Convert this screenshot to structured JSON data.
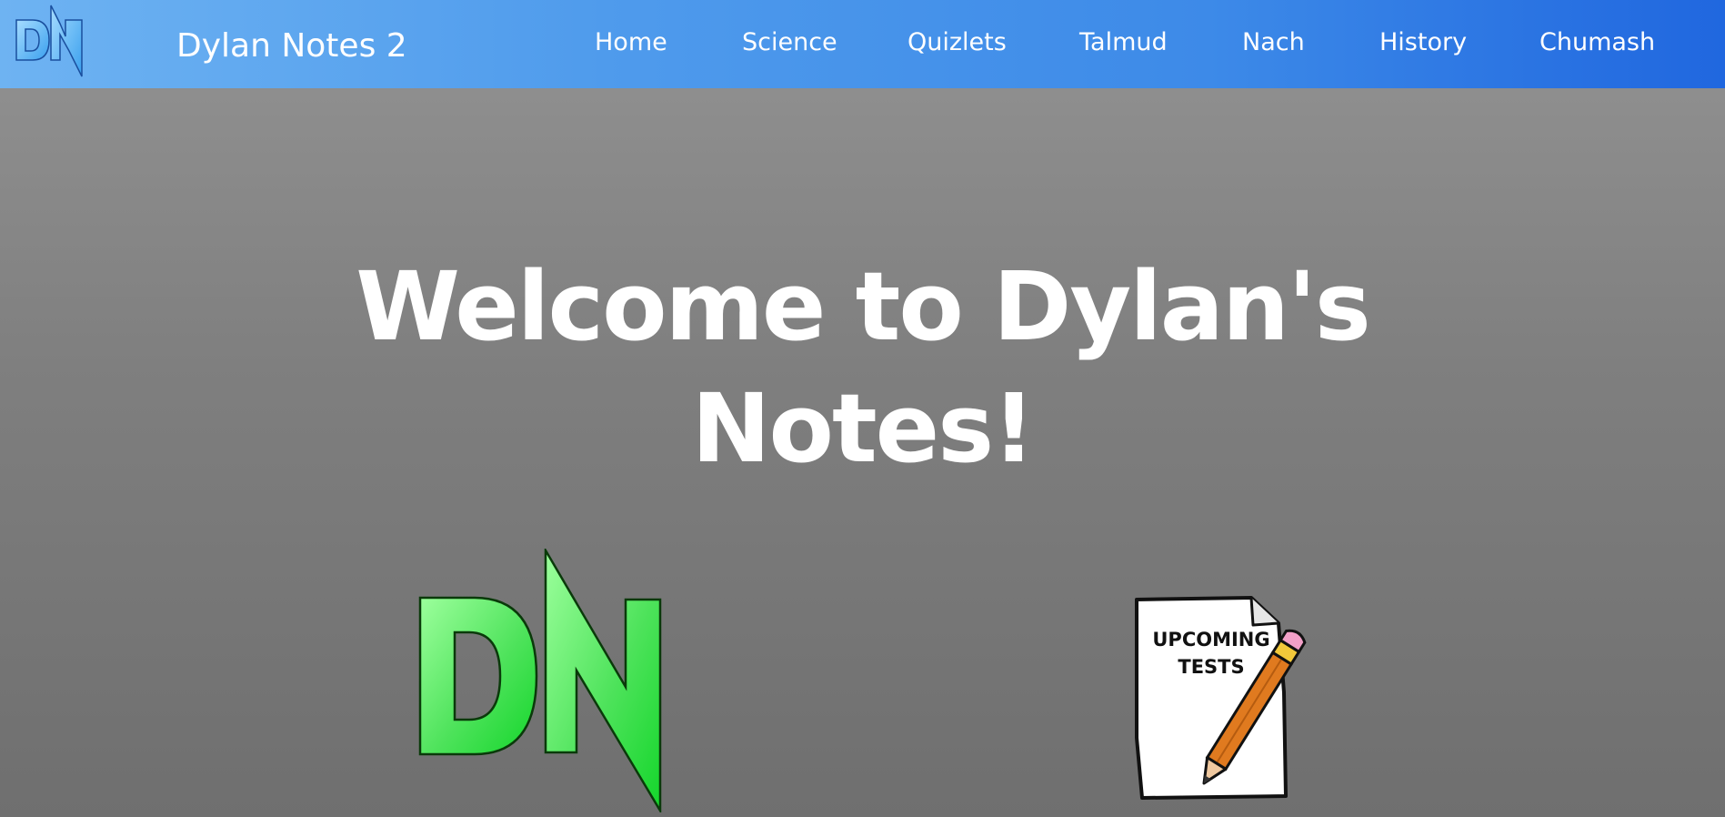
{
  "header": {
    "logo_text": "DN",
    "site_title": "Dylan Notes 2",
    "nav": [
      {
        "label": "Home"
      },
      {
        "label": "Science"
      },
      {
        "label": "Quizlets"
      },
      {
        "label": "Talmud"
      },
      {
        "label": "Nach"
      },
      {
        "label": "History"
      },
      {
        "label": "Chumash"
      }
    ]
  },
  "hero": {
    "title_line1": "Welcome to Dylan's",
    "title_line2": "Notes!"
  },
  "content": {
    "big_logo_text": "DN",
    "tests_card_line1": "UPCOMING",
    "tests_card_line2": "TESTS"
  },
  "colors": {
    "nav_gradient_start": "#6eb3f2",
    "nav_gradient_end": "#2067df",
    "page_background": "#7f7f7f",
    "logo_green": "#2edb3d",
    "pencil_orange": "#e07a1f"
  }
}
